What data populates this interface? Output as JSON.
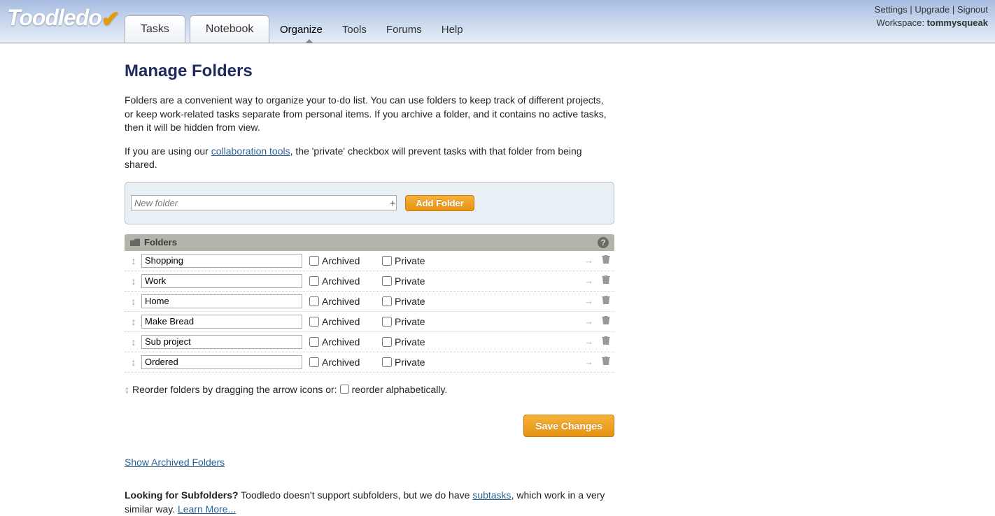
{
  "brand": "Toodledo",
  "topLinks": {
    "settings": "Settings",
    "upgrade": "Upgrade",
    "signout": "Signout"
  },
  "workspaceLabel": "Workspace:",
  "workspaceName": "tommysqueak",
  "nav": {
    "tasks": "Tasks",
    "notebook": "Notebook",
    "organize": "Organize",
    "tools": "Tools",
    "forums": "Forums",
    "help": "Help"
  },
  "page": {
    "title": "Manage Folders",
    "intro1": "Folders are a convenient way to organize your to-do list. You can use folders to keep track of different projects, or keep work-related tasks separate from personal items. If you archive a folder, and it contains no active tasks, then it will be hidden from view.",
    "intro2a": "If you are using our ",
    "intro2link": "collaboration tools",
    "intro2b": ", the 'private' checkbox will prevent tasks with that folder from being shared."
  },
  "add": {
    "placeholder": "New folder",
    "button": "Add Folder"
  },
  "section": {
    "title": "Folders"
  },
  "labels": {
    "archived": "Archived",
    "private": "Private"
  },
  "folders": [
    {
      "name": "Shopping"
    },
    {
      "name": "Work"
    },
    {
      "name": "Home"
    },
    {
      "name": "Make Bread"
    },
    {
      "name": "Sub project"
    },
    {
      "name": "Ordered"
    }
  ],
  "reorder": {
    "text1": "Reorder folders by dragging the arrow icons or:",
    "text2": "reorder alphabetically."
  },
  "save": "Save Changes",
  "showArchived": "Show Archived Folders",
  "sub": {
    "lead": "Looking for Subfolders?",
    "text1": " Toodledo doesn't support subfolders, but we do have ",
    "link1": "subtasks",
    "text2": ", which work in a very similar way. ",
    "link2": "Learn More..."
  }
}
